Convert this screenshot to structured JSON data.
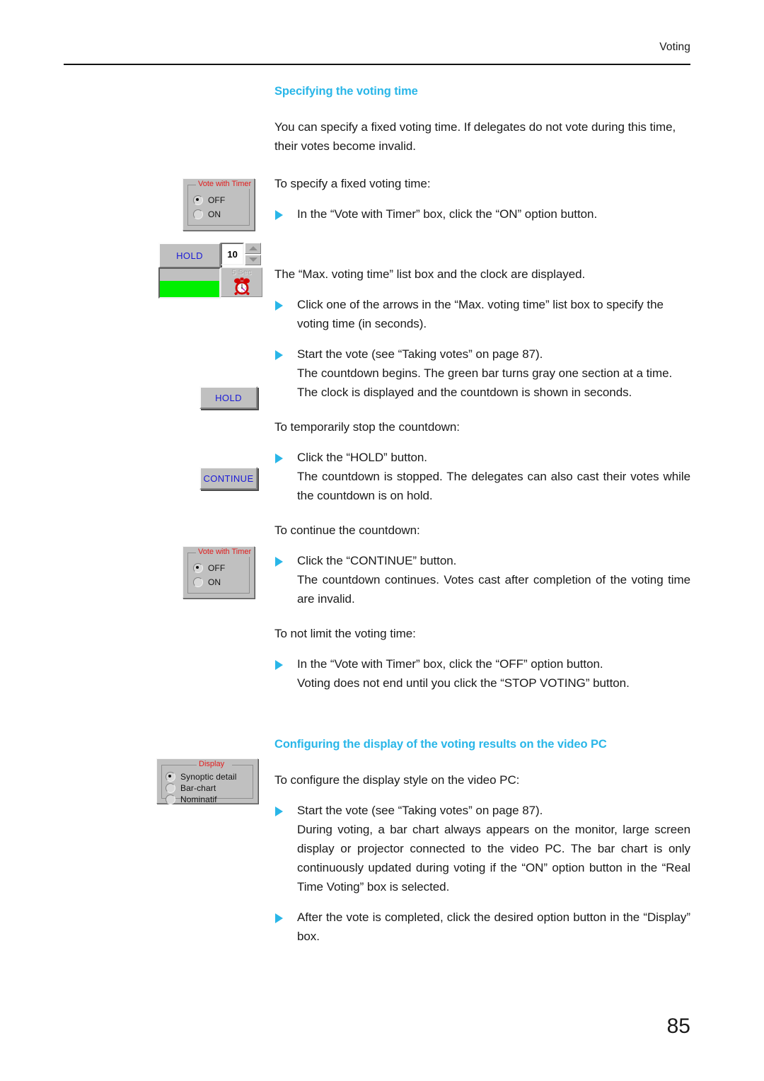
{
  "header": {
    "running_head": "Voting"
  },
  "sections": [
    {
      "heading": "Specifying the voting time",
      "blocks": [
        {
          "kind": "para",
          "text": "You can specify a fixed voting time. If delegates do not vote during this time, their votes become invalid."
        },
        {
          "kind": "para",
          "text": "To specify a fixed voting time:"
        },
        {
          "kind": "bullet",
          "text": "In the “Vote with Timer” box, click the “ON” option button."
        },
        {
          "kind": "para",
          "text": "The “Max. voting time” list box and the clock are displayed."
        },
        {
          "kind": "bullet",
          "text": "Click one of the arrows in the “Max. voting time” list box to specify the voting time (in seconds)."
        },
        {
          "kind": "bullet",
          "text": "Start the vote (see “Taking votes” on page 87)."
        },
        {
          "kind": "cont",
          "text": "The countdown begins. The green bar turns gray one section at a time. The clock is displayed and the countdown is shown in seconds."
        },
        {
          "kind": "para",
          "text": "To temporarily stop the countdown:"
        },
        {
          "kind": "bullet",
          "text": "Click the “HOLD” button."
        },
        {
          "kind": "cont-just",
          "text": "The countdown is stopped. The delegates can also cast their votes while the countdown is on hold."
        },
        {
          "kind": "para",
          "text": "To continue the countdown:"
        },
        {
          "kind": "bullet",
          "text": "Click the “CONTINUE” button."
        },
        {
          "kind": "cont-just",
          "text": "The countdown continues. Votes cast after completion of the voting time are invalid."
        },
        {
          "kind": "para",
          "text": "To not limit the voting time:"
        },
        {
          "kind": "bullet",
          "text": "In the “Vote with Timer” box, click the “OFF” option button."
        },
        {
          "kind": "cont",
          "text": "Voting does not end until you click the “STOP VOTING” button."
        }
      ]
    },
    {
      "heading": "Configuring the display of the voting results on the video PC",
      "blocks": [
        {
          "kind": "para",
          "text": "To configure the display style on the video PC:"
        },
        {
          "kind": "bullet",
          "text": "Start the vote (see “Taking votes” on page 87)."
        },
        {
          "kind": "cont-just",
          "text": "During voting, a bar chart always appears on the monitor, large screen display or projector connected to the video PC. The bar chart is only continuously updated during voting if the “ON” option button in the “Real Time Voting” box is selected."
        },
        {
          "kind": "bullet-just",
          "text": "After the vote is completed, click the desired option button in the “Display” box."
        }
      ]
    }
  ],
  "figures": {
    "vote_with_timer_top": {
      "legend": "Vote with Timer",
      "options": [
        {
          "label": "OFF",
          "selected": true
        },
        {
          "label": "ON",
          "selected": false
        }
      ]
    },
    "vote_with_timer_bottom": {
      "legend": "Vote with Timer",
      "options": [
        {
          "label": "OFF",
          "selected": true
        },
        {
          "label": "ON",
          "selected": false
        }
      ]
    },
    "timer_panel": {
      "hold_label": "HOLD",
      "max_voting_time_value": "10",
      "clock_label": "5 Sec",
      "progress_bar_color": "#00f000",
      "progress_fill_percent": 58
    },
    "hold_button": {
      "label": "HOLD"
    },
    "continue_button": {
      "label": "CONTINUE"
    },
    "display_box": {
      "legend": "Display",
      "options": [
        {
          "label": "Synoptic detail",
          "selected": true
        },
        {
          "label": "Bar-chart",
          "selected": false
        },
        {
          "label": "Nominatif",
          "selected": false
        }
      ]
    }
  },
  "footer": {
    "page_number": "85"
  },
  "colors": {
    "heading": "#29b6e8",
    "bullet": "#29b6e8",
    "legend_red": "#e21b1b",
    "button_text_blue": "#1919d6",
    "widget_face": "#c0c0c0",
    "progress_green": "#00f000"
  }
}
